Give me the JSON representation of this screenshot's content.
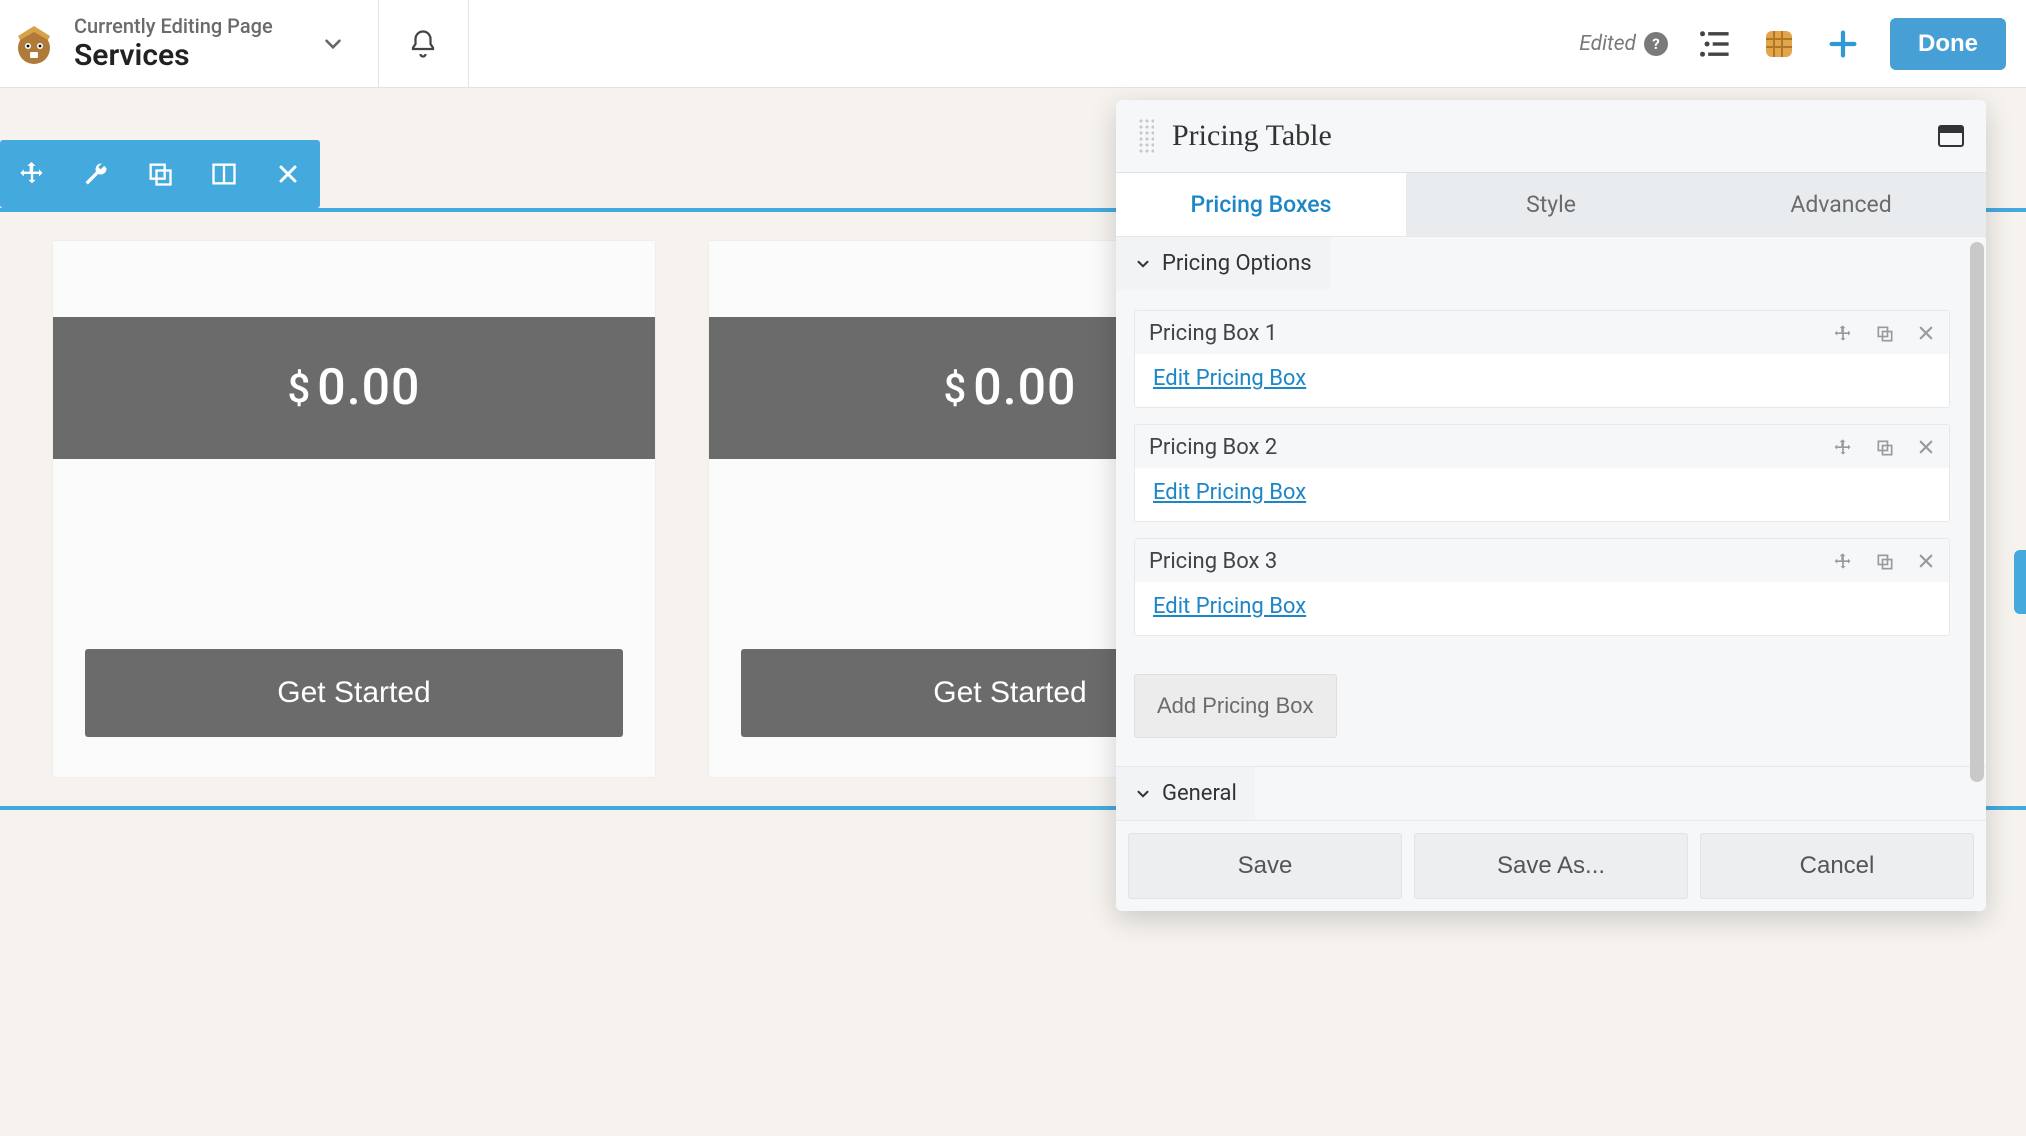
{
  "topbar": {
    "editing_label": "Currently Editing Page",
    "page_title": "Services",
    "edited_label": "Edited",
    "done_label": "Done"
  },
  "canvas": {
    "cards": [
      {
        "price": "0.00",
        "currency": "$",
        "cta": "Get Started"
      },
      {
        "price": "0.00",
        "currency": "$",
        "cta": "Get Started"
      }
    ]
  },
  "panel": {
    "title": "Pricing Table",
    "tabs": {
      "boxes": "Pricing Boxes",
      "style": "Style",
      "advanced": "Advanced"
    },
    "sections": {
      "pricing_options": {
        "label": "Pricing Options",
        "items": [
          {
            "title": "Pricing Box 1",
            "edit_label": "Edit Pricing Box"
          },
          {
            "title": "Pricing Box 2",
            "edit_label": "Edit Pricing Box"
          },
          {
            "title": "Pricing Box 3",
            "edit_label": "Edit Pricing Box"
          }
        ],
        "add_label": "Add Pricing Box"
      },
      "general": {
        "label": "General"
      }
    },
    "footer": {
      "save": "Save",
      "save_as": "Save As...",
      "cancel": "Cancel"
    }
  }
}
